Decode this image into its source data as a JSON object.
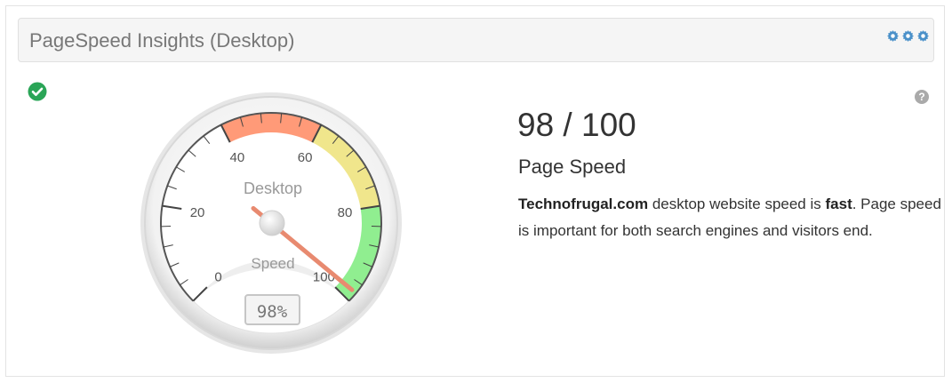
{
  "panel": {
    "title": "PageSpeed Insights (Desktop)",
    "settings_icons": [
      "gear-icon",
      "gear-icon",
      "gear-icon"
    ],
    "status_icon": "check-circle-icon",
    "help_icon": "question-circle-icon"
  },
  "gauge": {
    "label_top": "Desktop",
    "label_bottom": "Speed",
    "readout": "98%",
    "value": 98,
    "min": 0,
    "max": 100,
    "tick_labels": [
      "0",
      "20",
      "40",
      "60",
      "80",
      "100"
    ],
    "colors": {
      "red_zone": "#ff9a78",
      "yellow_zone": "#f0e68c",
      "green_zone": "#90ee90",
      "needle": "#e88a70",
      "accent": "#4a90c9",
      "success": "#2aa557"
    }
  },
  "result": {
    "score": "98 / 100",
    "heading": "Page Speed",
    "site": "Technofrugal.com",
    "text_before": " desktop website speed is ",
    "rating": "fast",
    "text_after": ". Page speed is important for both search engines and visitors end."
  }
}
